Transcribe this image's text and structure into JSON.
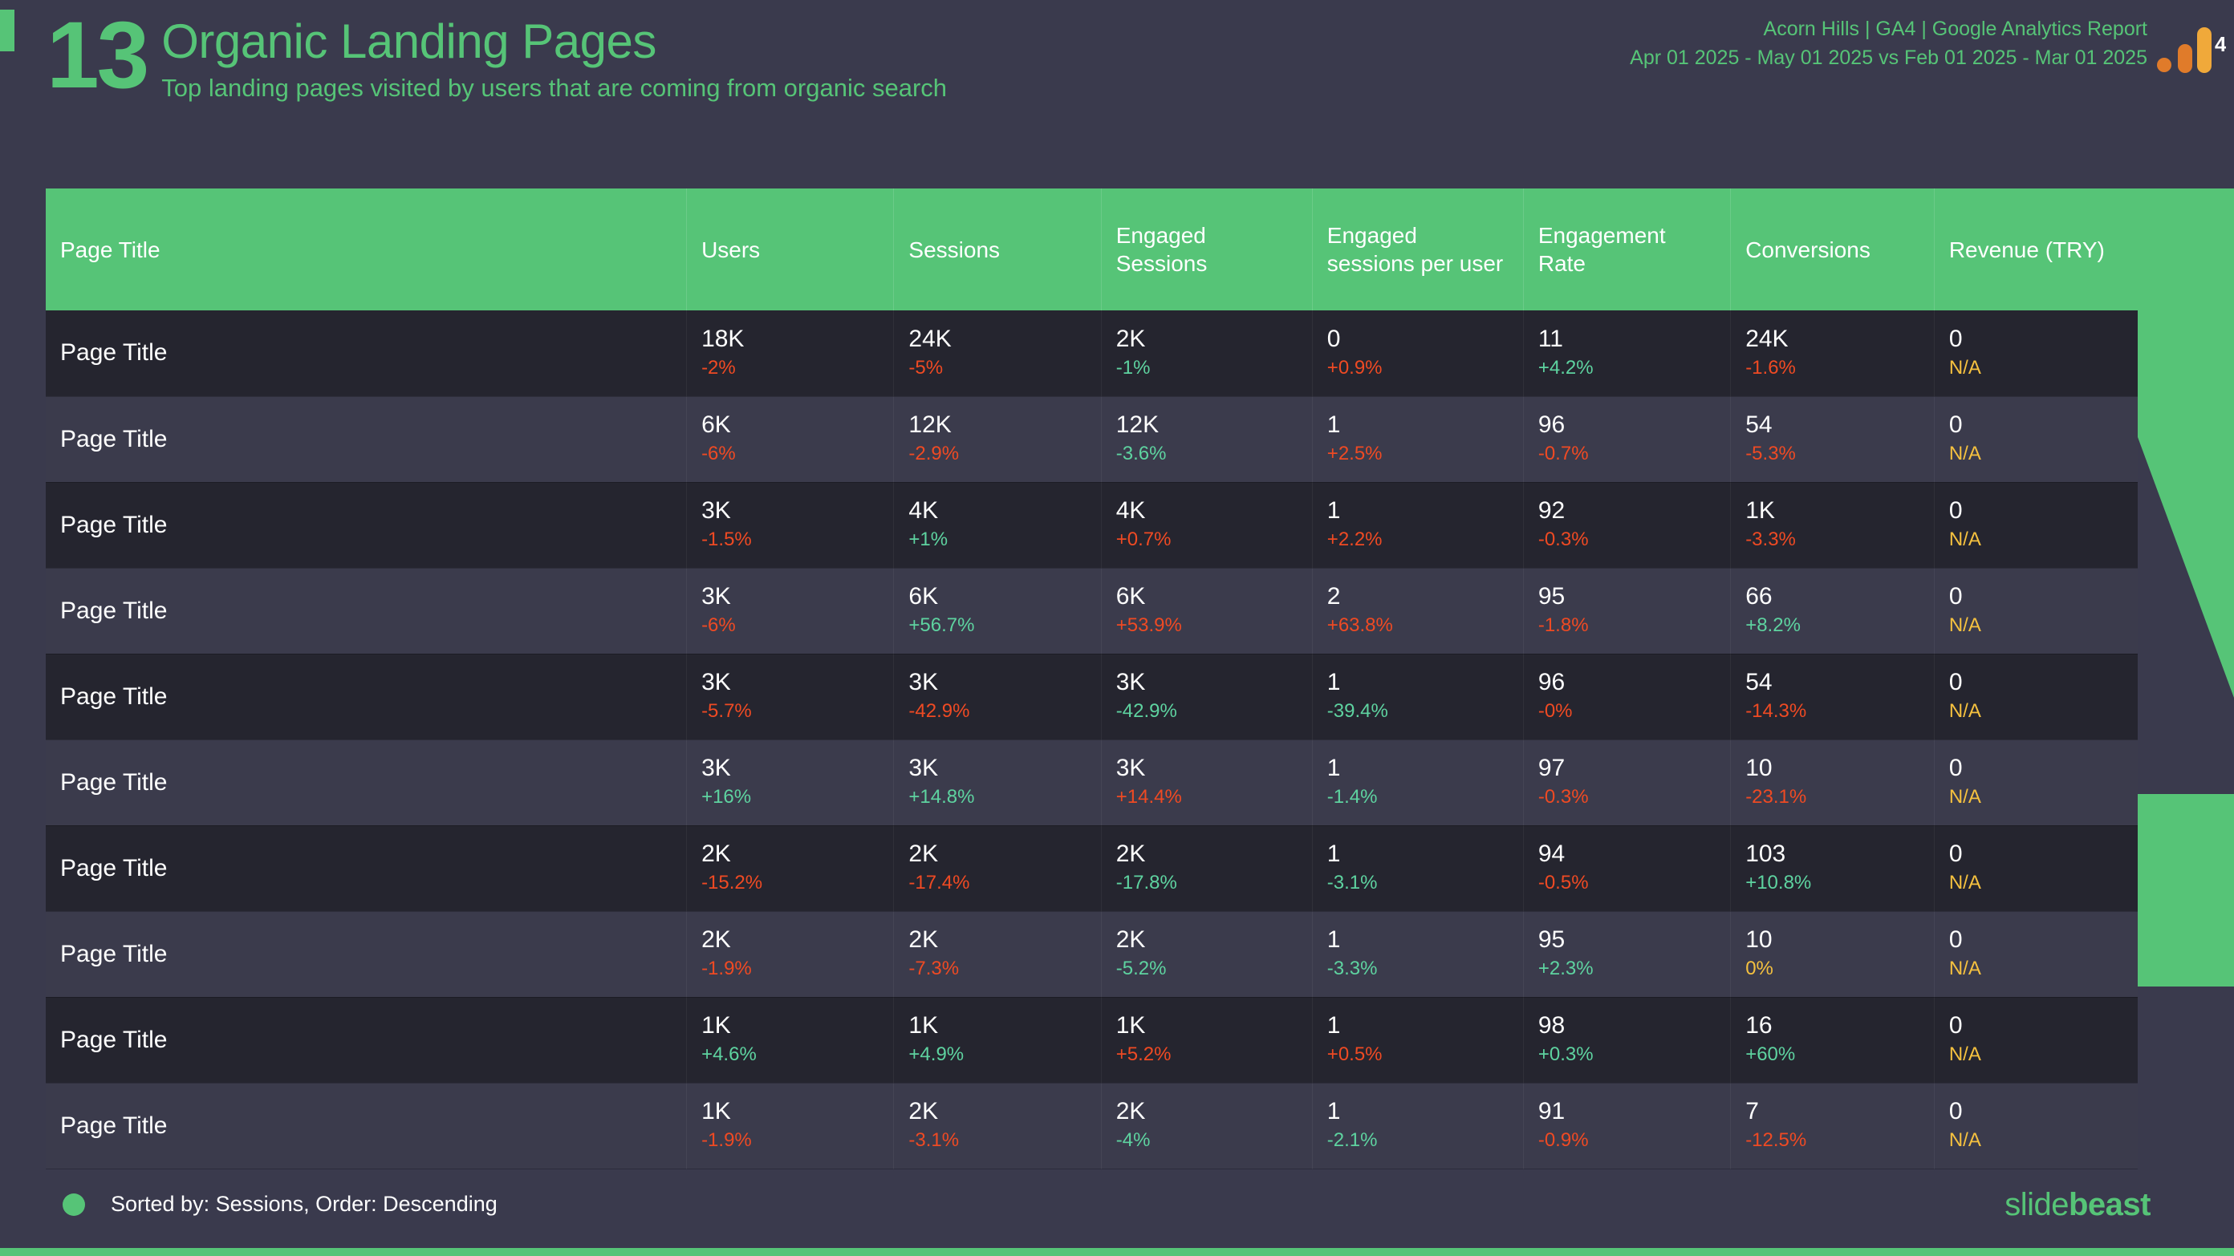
{
  "header": {
    "number": "13",
    "title": "Organic Landing Pages",
    "subtitle": "Top landing pages visited by users that are coming from organic search",
    "account_line": "Acorn Hills | GA4 | Google Analytics Report",
    "date_range_line": "Apr 01 2025 - May 01 2025 vs Feb 01 2025 - Mar 01 2025",
    "logo_badge": "4",
    "logo_name": "google-analytics-logo"
  },
  "colors": {
    "accent_green": "#56c477",
    "page_bg": "#3a3a4d",
    "row_odd": "#25252f",
    "row_even": "#3b3b4c",
    "delta_up": "#5ed3a0",
    "delta_down": "#ef4a23",
    "delta_na": "#f5c13f",
    "logo_orange_dark": "#e07b2a",
    "logo_orange_light": "#f0a93a"
  },
  "table": {
    "columns": [
      "Page Title",
      "Users",
      "Sessions",
      "Engaged Sessions",
      "Engaged sessions per user",
      "Engagement Rate",
      "Conversions",
      "Revenue (TRY)"
    ],
    "rows": [
      {
        "page_title": "Page Title",
        "cells": [
          {
            "value": "18K",
            "delta": "-2%",
            "tone": "down"
          },
          {
            "value": "24K",
            "delta": "-5%",
            "tone": "down"
          },
          {
            "value": "2K",
            "delta": "-1%",
            "tone": "up"
          },
          {
            "value": "0",
            "delta": "+0.9%",
            "tone": "down"
          },
          {
            "value": "11",
            "delta": "+4.2%",
            "tone": "up"
          },
          {
            "value": "24K",
            "delta": "-1.6%",
            "tone": "down"
          },
          {
            "value": "0",
            "delta": "N/A",
            "tone": "na"
          }
        ]
      },
      {
        "page_title": "Page Title",
        "cells": [
          {
            "value": "6K",
            "delta": "-6%",
            "tone": "down"
          },
          {
            "value": "12K",
            "delta": "-2.9%",
            "tone": "down"
          },
          {
            "value": "12K",
            "delta": "-3.6%",
            "tone": "up"
          },
          {
            "value": "1",
            "delta": "+2.5%",
            "tone": "down"
          },
          {
            "value": "96",
            "delta": "-0.7%",
            "tone": "down"
          },
          {
            "value": "54",
            "delta": "-5.3%",
            "tone": "down"
          },
          {
            "value": "0",
            "delta": "N/A",
            "tone": "na"
          }
        ]
      },
      {
        "page_title": "Page Title",
        "cells": [
          {
            "value": "3K",
            "delta": "-1.5%",
            "tone": "down"
          },
          {
            "value": "4K",
            "delta": "+1%",
            "tone": "up"
          },
          {
            "value": "4K",
            "delta": "+0.7%",
            "tone": "down"
          },
          {
            "value": "1",
            "delta": "+2.2%",
            "tone": "down"
          },
          {
            "value": "92",
            "delta": "-0.3%",
            "tone": "down"
          },
          {
            "value": "1K",
            "delta": "-3.3%",
            "tone": "down"
          },
          {
            "value": "0",
            "delta": "N/A",
            "tone": "na"
          }
        ]
      },
      {
        "page_title": "Page Title",
        "cells": [
          {
            "value": "3K",
            "delta": "-6%",
            "tone": "down"
          },
          {
            "value": "6K",
            "delta": "+56.7%",
            "tone": "up"
          },
          {
            "value": "6K",
            "delta": "+53.9%",
            "tone": "down"
          },
          {
            "value": "2",
            "delta": "+63.8%",
            "tone": "down"
          },
          {
            "value": "95",
            "delta": "-1.8%",
            "tone": "down"
          },
          {
            "value": "66",
            "delta": "+8.2%",
            "tone": "up"
          },
          {
            "value": "0",
            "delta": "N/A",
            "tone": "na"
          }
        ]
      },
      {
        "page_title": "Page Title",
        "cells": [
          {
            "value": "3K",
            "delta": "-5.7%",
            "tone": "down"
          },
          {
            "value": "3K",
            "delta": "-42.9%",
            "tone": "down"
          },
          {
            "value": "3K",
            "delta": "-42.9%",
            "tone": "up"
          },
          {
            "value": "1",
            "delta": "-39.4%",
            "tone": "up"
          },
          {
            "value": "96",
            "delta": "-0%",
            "tone": "down"
          },
          {
            "value": "54",
            "delta": "-14.3%",
            "tone": "down"
          },
          {
            "value": "0",
            "delta": "N/A",
            "tone": "na"
          }
        ]
      },
      {
        "page_title": "Page Title",
        "cells": [
          {
            "value": "3K",
            "delta": "+16%",
            "tone": "up"
          },
          {
            "value": "3K",
            "delta": "+14.8%",
            "tone": "up"
          },
          {
            "value": "3K",
            "delta": "+14.4%",
            "tone": "down"
          },
          {
            "value": "1",
            "delta": "-1.4%",
            "tone": "up"
          },
          {
            "value": "97",
            "delta": "-0.3%",
            "tone": "down"
          },
          {
            "value": "10",
            "delta": "-23.1%",
            "tone": "down"
          },
          {
            "value": "0",
            "delta": "N/A",
            "tone": "na"
          }
        ]
      },
      {
        "page_title": "Page Title",
        "cells": [
          {
            "value": "2K",
            "delta": "-15.2%",
            "tone": "down"
          },
          {
            "value": "2K",
            "delta": "-17.4%",
            "tone": "down"
          },
          {
            "value": "2K",
            "delta": "-17.8%",
            "tone": "up"
          },
          {
            "value": "1",
            "delta": "-3.1%",
            "tone": "up"
          },
          {
            "value": "94",
            "delta": "-0.5%",
            "tone": "down"
          },
          {
            "value": "103",
            "delta": "+10.8%",
            "tone": "up"
          },
          {
            "value": "0",
            "delta": "N/A",
            "tone": "na"
          }
        ]
      },
      {
        "page_title": "Page Title",
        "cells": [
          {
            "value": "2K",
            "delta": "-1.9%",
            "tone": "down"
          },
          {
            "value": "2K",
            "delta": "-7.3%",
            "tone": "down"
          },
          {
            "value": "2K",
            "delta": "-5.2%",
            "tone": "up"
          },
          {
            "value": "1",
            "delta": "-3.3%",
            "tone": "up"
          },
          {
            "value": "95",
            "delta": "+2.3%",
            "tone": "up"
          },
          {
            "value": "10",
            "delta": "0%",
            "tone": "na"
          },
          {
            "value": "0",
            "delta": "N/A",
            "tone": "na"
          }
        ]
      },
      {
        "page_title": "Page Title",
        "cells": [
          {
            "value": "1K",
            "delta": "+4.6%",
            "tone": "up"
          },
          {
            "value": "1K",
            "delta": "+4.9%",
            "tone": "up"
          },
          {
            "value": "1K",
            "delta": "+5.2%",
            "tone": "down"
          },
          {
            "value": "1",
            "delta": "+0.5%",
            "tone": "down"
          },
          {
            "value": "98",
            "delta": "+0.3%",
            "tone": "up"
          },
          {
            "value": "16",
            "delta": "+60%",
            "tone": "up"
          },
          {
            "value": "0",
            "delta": "N/A",
            "tone": "na"
          }
        ]
      },
      {
        "page_title": "Page Title",
        "cells": [
          {
            "value": "1K",
            "delta": "-1.9%",
            "tone": "down"
          },
          {
            "value": "2K",
            "delta": "-3.1%",
            "tone": "down"
          },
          {
            "value": "2K",
            "delta": "-4%",
            "tone": "up"
          },
          {
            "value": "1",
            "delta": "-2.1%",
            "tone": "up"
          },
          {
            "value": "91",
            "delta": "-0.9%",
            "tone": "down"
          },
          {
            "value": "7",
            "delta": "-12.5%",
            "tone": "down"
          },
          {
            "value": "0",
            "delta": "N/A",
            "tone": "na"
          }
        ]
      }
    ]
  },
  "footer": {
    "sorted_text": "Sorted by: Sessions, Order: Descending",
    "brand_light": "slide",
    "brand_bold": "beast"
  }
}
